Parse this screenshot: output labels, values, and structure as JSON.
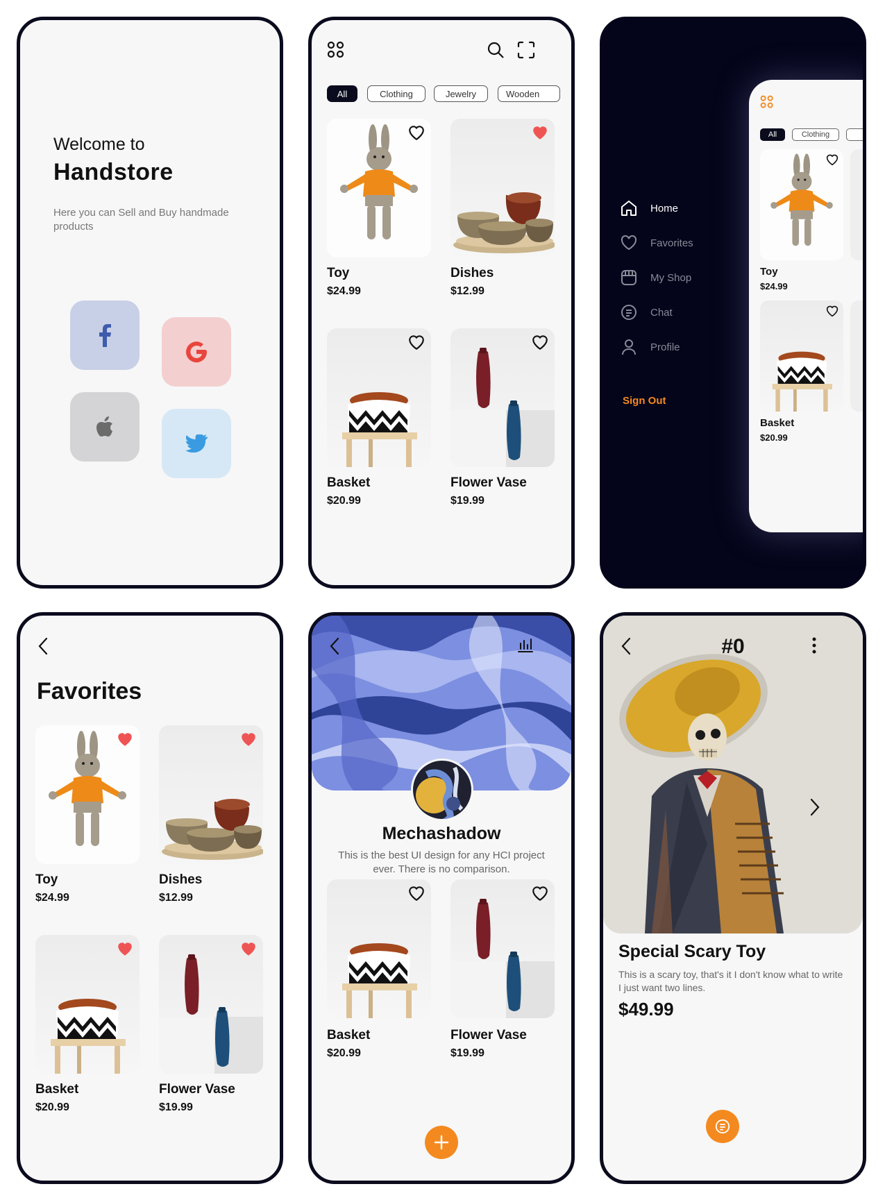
{
  "welcome": {
    "pre_title": "Welcome to",
    "title": "Handstore",
    "subtitle": "Here you can Sell and Buy handmade products",
    "social_buttons": [
      {
        "name": "facebook",
        "icon": "facebook-icon",
        "color": "#c7d0e6"
      },
      {
        "name": "google",
        "icon": "google-icon",
        "color": "#f4cfcf"
      },
      {
        "name": "apple",
        "icon": "apple-icon",
        "color": "#d4d4d6"
      },
      {
        "name": "twitter",
        "icon": "twitter-icon",
        "color": "#d6e8f6"
      }
    ]
  },
  "home": {
    "categories": [
      "All",
      "Clothing",
      "Jewelry",
      "Wooden"
    ],
    "active_category": "All",
    "products": [
      {
        "name": "Toy",
        "price": "$24.99",
        "favorited": false
      },
      {
        "name": "Dishes",
        "price": "$12.99",
        "favorited": true
      },
      {
        "name": "Basket",
        "price": "$20.99",
        "favorited": false
      },
      {
        "name": "Flower Vase",
        "price": "$19.99",
        "favorited": false
      }
    ]
  },
  "menu": {
    "items": [
      "Home",
      "Favorites",
      "My Shop",
      "Chat",
      "Profile"
    ],
    "active_item": "Home",
    "sign_out": "Sign Out",
    "preview_categories": [
      "All",
      "Clothing"
    ],
    "preview_products": [
      {
        "name": "Toy",
        "price": "$24.99"
      },
      {
        "name": "Basket",
        "price": "$20.99"
      }
    ]
  },
  "favorites": {
    "title": "Favorites",
    "products": [
      {
        "name": "Toy",
        "price": "$24.99"
      },
      {
        "name": "Dishes",
        "price": "$12.99"
      },
      {
        "name": "Basket",
        "price": "$20.99"
      },
      {
        "name": "Flower Vase",
        "price": "$19.99"
      }
    ]
  },
  "profile": {
    "username": "Mechashadow",
    "bio": "This is the best UI design for any HCI project ever. There is no comparison.",
    "products": [
      {
        "name": "Basket",
        "price": "$20.99"
      },
      {
        "name": "Flower Vase",
        "price": "$19.99"
      }
    ]
  },
  "detail": {
    "index": "#0",
    "name": "Special Scary Toy",
    "description": "This is a scary toy, that's it I don't know what to write I just want two lines.",
    "price": "$49.99"
  },
  "colors": {
    "accent": "#f48a1f",
    "dark": "#0b0b1e",
    "heart_filled": "#ef5454"
  }
}
